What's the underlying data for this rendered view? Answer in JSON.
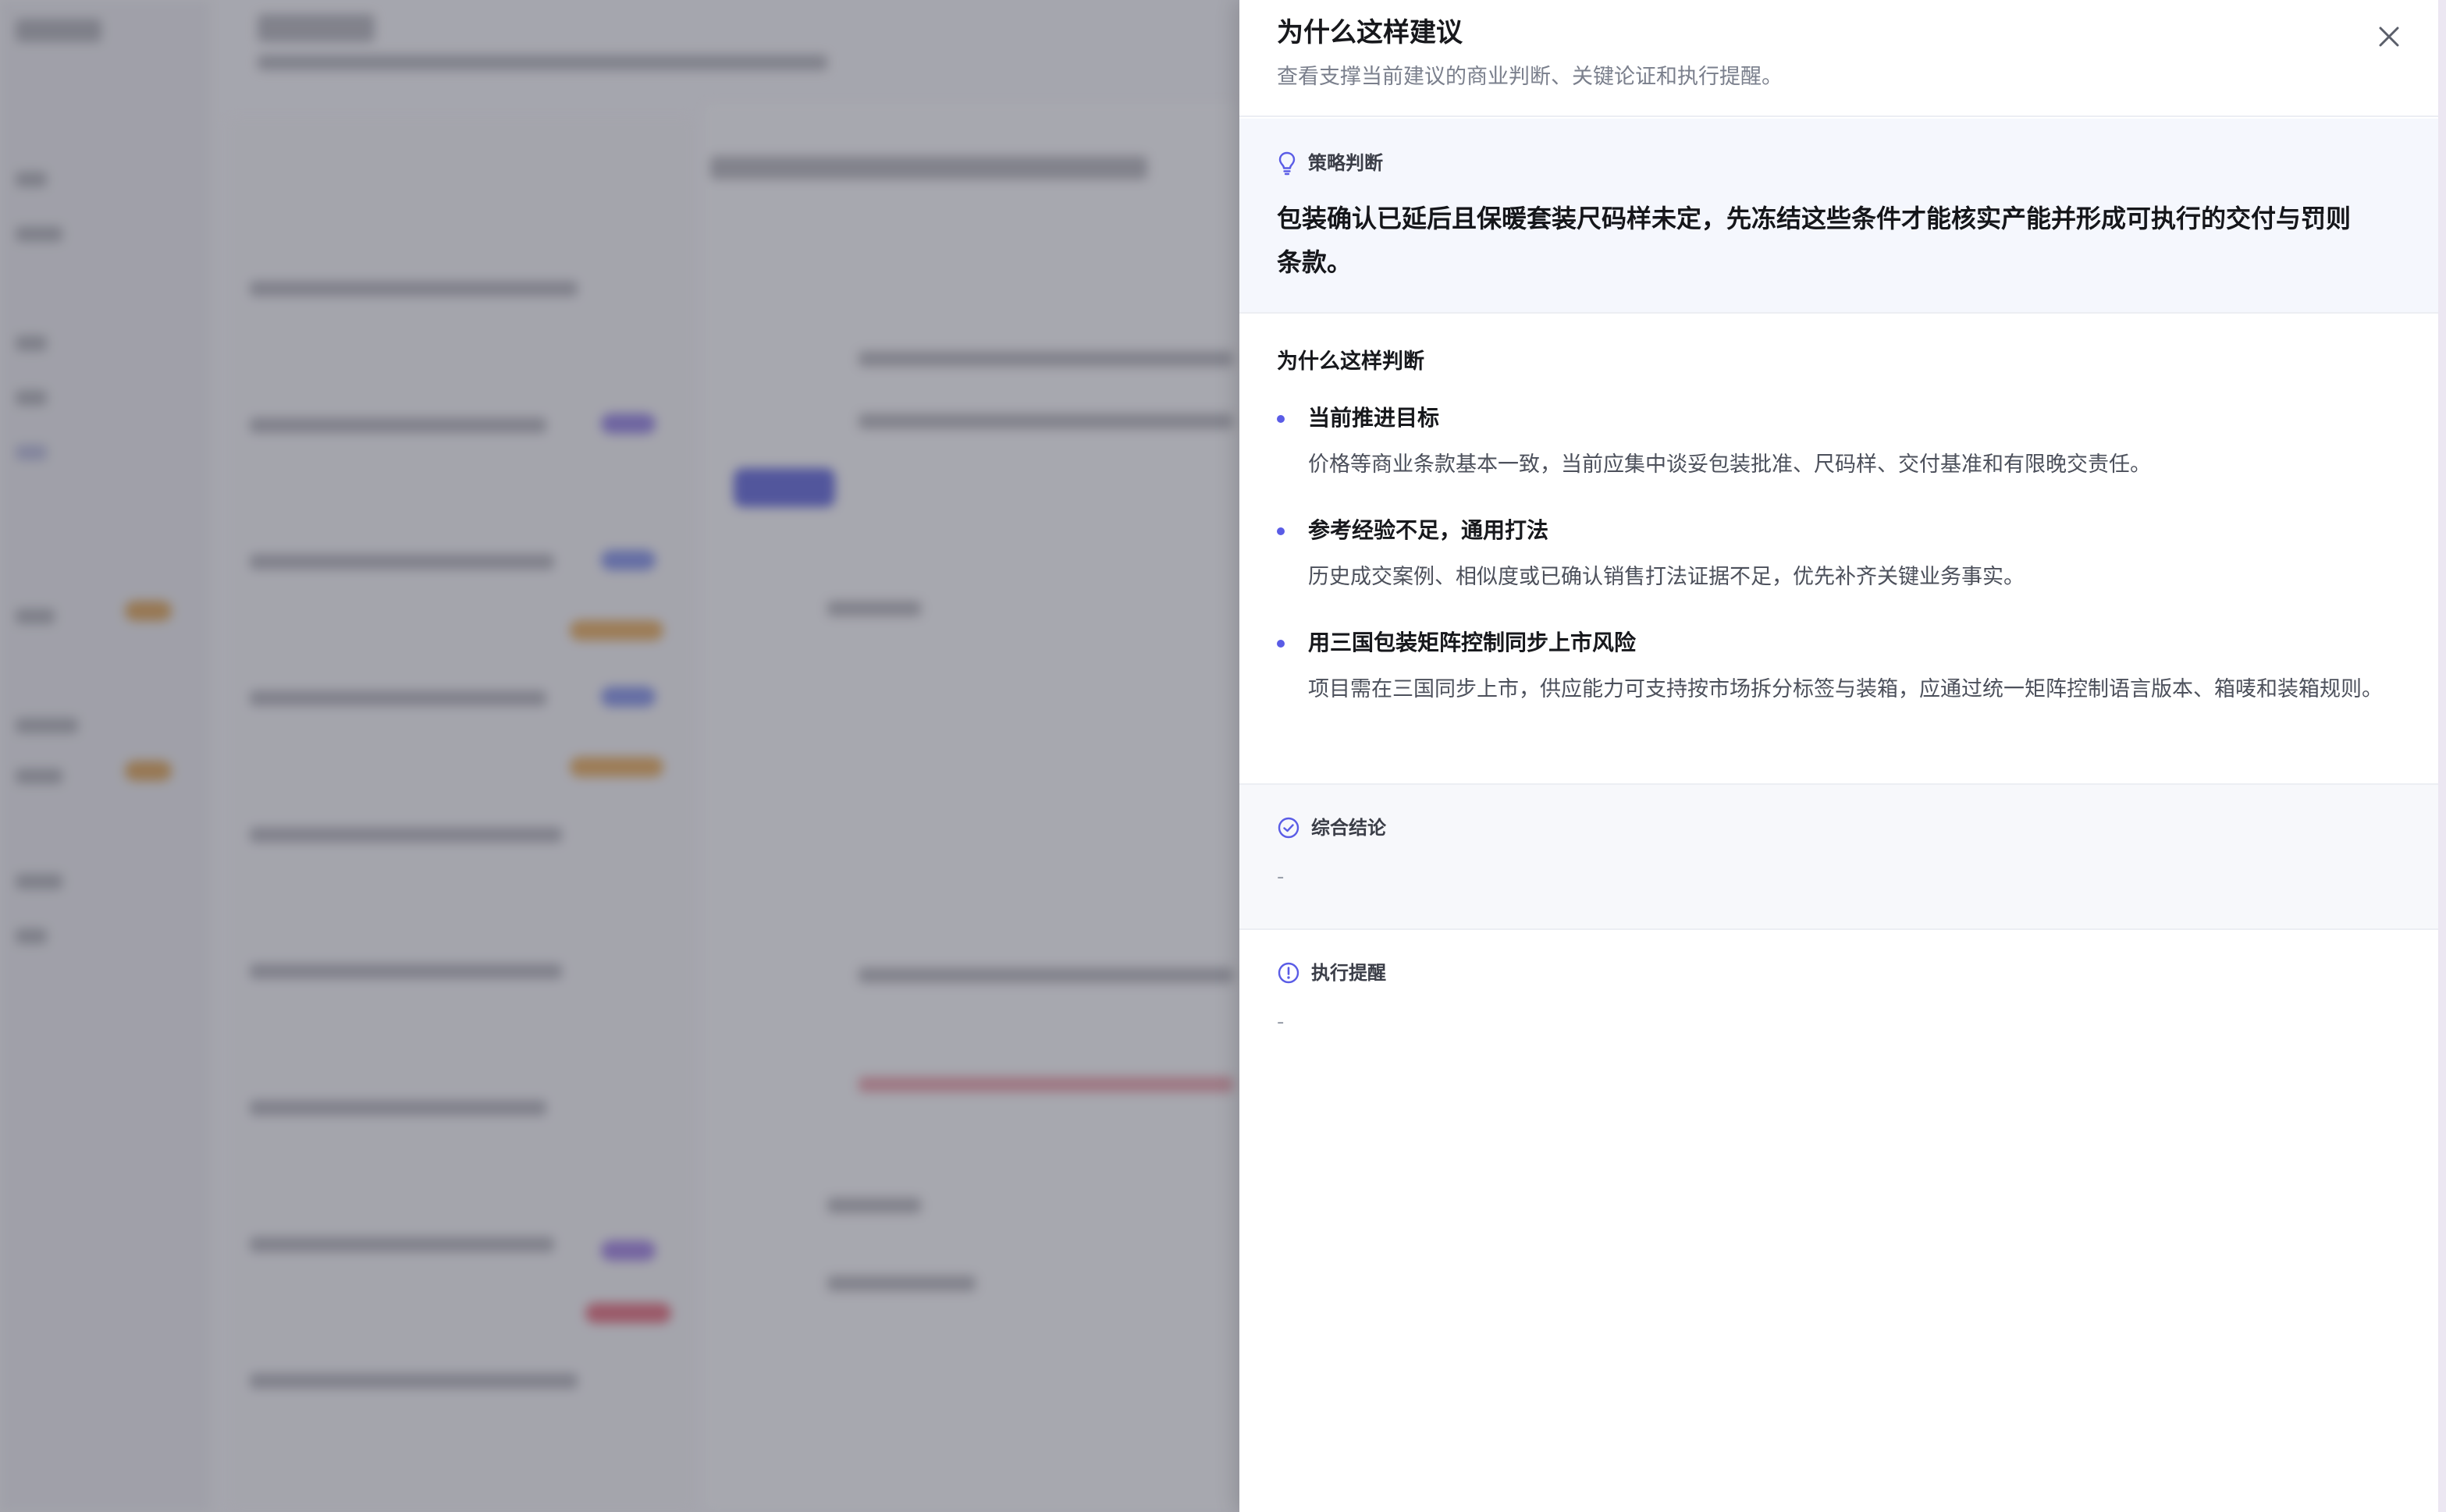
{
  "drawer": {
    "title": "为什么这样建议",
    "subtitle": "查看支撑当前建议的商业判断、关键论证和执行提醒。",
    "close_icon": "close-icon"
  },
  "strategy": {
    "label": "策略判断",
    "icon": "lightbulb-icon",
    "text": "包装确认已延后且保暖套装尺码样未定，先冻结这些条件才能核实产能并形成可执行的交付与罚则条款。"
  },
  "reasons": {
    "title": "为什么这样判断",
    "items": [
      {
        "title": "当前推进目标",
        "desc": "价格等商业条款基本一致，当前应集中谈妥包装批准、尺码样、交付基准和有限晚交责任。"
      },
      {
        "title": "参考经验不足，通用打法",
        "desc": "历史成交案例、相似度或已确认销售打法证据不足，优先补齐关键业务事实。"
      },
      {
        "title": "用三国包装矩阵控制同步上市风险",
        "desc": "项目需在三国同步上市，供应能力可支持按市场拆分标签与装箱，应通过统一矩阵控制语言版本、箱唛和装箱规则。"
      }
    ]
  },
  "conclusion": {
    "label": "综合结论",
    "icon": "check-circle-icon",
    "value": "-"
  },
  "reminder": {
    "label": "执行提醒",
    "icon": "alert-circle-icon",
    "value": "-"
  },
  "colors": {
    "accent": "#5a5ce6",
    "strategy_bg": "#f5f7fd",
    "scrim": "#464854"
  }
}
